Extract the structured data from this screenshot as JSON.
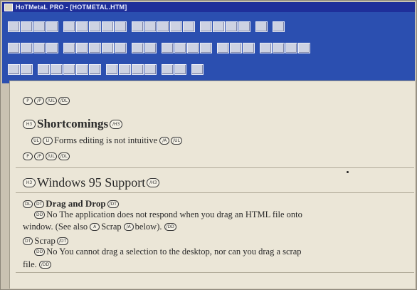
{
  "window": {
    "title": "HoTMetaL PRO - [HOTMETAL.HTM]"
  },
  "document": {
    "tags": {
      "p_open": "P",
      "p_close": "/P",
      "h3_open": "H3",
      "h3_close": "/H3",
      "ul_open": "UL",
      "ul_close": "/UL",
      "li_open": "LI",
      "dt_open": "DT",
      "dd_open": "DD",
      "dl_open": "DL",
      "dl_close": "/DL",
      "a_open": "A",
      "a_close": "/A",
      "dt_close": "/DT",
      "dd_close": "/DD"
    },
    "shortcomings_heading": "Shortcomings",
    "shortcoming_item": "Forms editing is not intuitive",
    "windows95_heading": "Windows 95 Support",
    "drag_drop_label": "Drag and Drop",
    "drag_drop_text_1": "No  The application does not respond when you drag an HTML file onto",
    "drag_drop_text_2": "window. (See also",
    "drag_drop_link": "Scrap",
    "drag_drop_text_3": "below).",
    "scrap_label": "Scrap",
    "scrap_text_1": "No  You cannot drag a selection to the desktop, nor can you drag a scrap",
    "scrap_text_2": "file."
  }
}
